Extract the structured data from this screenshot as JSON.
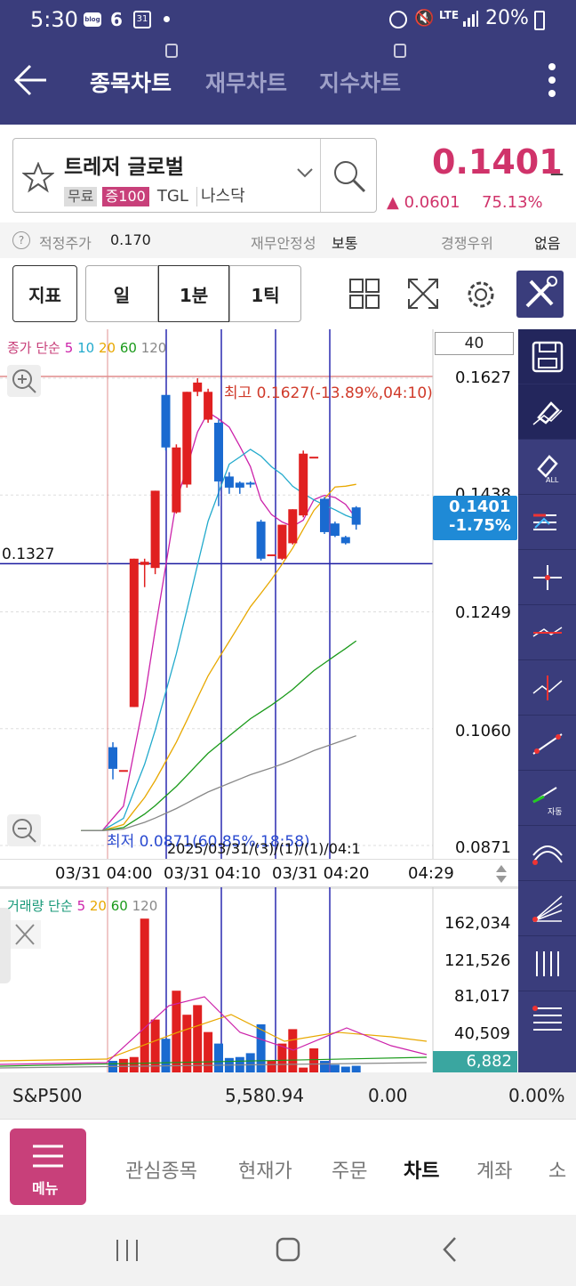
{
  "status": {
    "time": "5:30",
    "icons": [
      "blog-icon",
      "b-icon",
      "calendar-31-icon",
      "dot-icon"
    ],
    "calendar_day": "31",
    "blog": "blog",
    "network": "LTE",
    "battery": "20%"
  },
  "header": {
    "tabs": [
      "종목차트",
      "재무차트",
      "지수차트"
    ],
    "active_tab": 0
  },
  "stock": {
    "name": "트레저 글로벌",
    "badges": [
      "무료",
      "증100",
      "TGL",
      "나스닥"
    ],
    "price": "0.1401",
    "change": "▲ 0.0601",
    "change_pct": "75.13%",
    "price_suffix": "_"
  },
  "info": {
    "fair_price_label": "적정주가",
    "fair_price": "0.170",
    "stability_label": "재무안정성",
    "stability": "보통",
    "competitive_label": "경쟁우위",
    "competitive": "없음",
    "help": "?"
  },
  "toolbar": {
    "indicator": "지표",
    "periods": [
      "일",
      "1분",
      "1틱"
    ],
    "active_period": 1
  },
  "chart": {
    "count_box": "40",
    "ma_legend": {
      "prefix": "종가 단순",
      "periods": [
        "5",
        "10",
        "20",
        "60",
        "120"
      ],
      "colors": [
        "#cc22aa",
        "#22aacc",
        "#e8a800",
        "#1a9a1a",
        "#888888"
      ]
    },
    "high_label": "최고 0.1627(-13.89%,04:10)",
    "low_label": "최저 0.0871(60.85%,18:58)",
    "crosshair_price": "0.1327",
    "overlap_date": "2025/03/31/(3)/(1)/(1)/04:1",
    "current_price": "0.1401",
    "current_pct": "-1.75%",
    "y_ticks": [
      "0.1627",
      "0.1438",
      "0.1249",
      "0.1060",
      "0.0871"
    ],
    "x_ticks": [
      "03/31 04:00",
      "03/31 04:10",
      "03/31 04:20",
      "04:29"
    ],
    "volume_legend": {
      "prefix": "거래량 단순",
      "periods": [
        "5",
        "20",
        "60",
        "120"
      ],
      "colors": [
        "#cc22aa",
        "#e8a800",
        "#1a9a1a",
        "#888888"
      ]
    },
    "volume_ticks": [
      "162,034",
      "121,526",
      "81,017",
      "40,509"
    ],
    "volume_current": "6,882"
  },
  "chart_data": {
    "type": "candlestick",
    "ylim": [
      0.0871,
      0.1627
    ],
    "candles": [
      {
        "o": 0.103,
        "c": 0.0995,
        "h": 0.1038,
        "l": 0.0978
      },
      {
        "o": 0.0993,
        "c": 0.0993,
        "h": 0.0993,
        "l": 0.0993
      },
      {
        "o": 0.1095,
        "c": 0.1335,
        "h": 0.1335,
        "l": 0.1095
      },
      {
        "o": 0.1325,
        "c": 0.133,
        "h": 0.1335,
        "l": 0.1289
      },
      {
        "o": 0.132,
        "c": 0.1445,
        "h": 0.1445,
        "l": 0.131
      },
      {
        "o": 0.16,
        "c": 0.1515,
        "h": 0.16,
        "l": 0.151
      },
      {
        "o": 0.141,
        "c": 0.1515,
        "h": 0.152,
        "l": 0.1408
      },
      {
        "o": 0.1455,
        "c": 0.1605,
        "h": 0.1605,
        "l": 0.145
      },
      {
        "o": 0.1605,
        "c": 0.162,
        "h": 0.1627,
        "l": 0.1598
      },
      {
        "o": 0.156,
        "c": 0.1605,
        "h": 0.161,
        "l": 0.1555
      },
      {
        "o": 0.1555,
        "c": 0.146,
        "h": 0.156,
        "l": 0.142
      },
      {
        "o": 0.1468,
        "c": 0.145,
        "h": 0.1475,
        "l": 0.144
      },
      {
        "o": 0.1458,
        "c": 0.145,
        "h": 0.146,
        "l": 0.144
      },
      {
        "o": 0.1458,
        "c": 0.1455,
        "h": 0.146,
        "l": 0.145
      },
      {
        "o": 0.1395,
        "c": 0.1335,
        "h": 0.1398,
        "l": 0.1332
      },
      {
        "o": 0.1342,
        "c": 0.1342,
        "h": 0.1342,
        "l": 0.1342
      },
      {
        "o": 0.1335,
        "c": 0.139,
        "h": 0.139,
        "l": 0.1333
      },
      {
        "o": 0.136,
        "c": 0.1415,
        "h": 0.1415,
        "l": 0.1358
      },
      {
        "o": 0.1405,
        "c": 0.1505,
        "h": 0.151,
        "l": 0.1402
      },
      {
        "o": 0.15,
        "c": 0.15,
        "h": 0.15,
        "l": 0.15
      },
      {
        "o": 0.1432,
        "c": 0.1378,
        "h": 0.1435,
        "l": 0.1375
      },
      {
        "o": 0.1392,
        "c": 0.1372,
        "h": 0.1395,
        "l": 0.137
      },
      {
        "o": 0.137,
        "c": 0.136,
        "h": 0.1372,
        "l": 0.1358
      },
      {
        "o": 0.1418,
        "c": 0.139,
        "h": 0.142,
        "l": 0.1382
      }
    ],
    "volumes": [
      12000,
      14000,
      16000,
      160000,
      55000,
      35000,
      85000,
      60000,
      70000,
      42000,
      30000,
      15000,
      16000,
      20000,
      50000,
      12000,
      30000,
      45000,
      5000,
      25000,
      12000,
      8000,
      6000,
      6882
    ]
  },
  "sp": {
    "label": "S&P500",
    "value": "5,580.94",
    "change": "0.00",
    "pct": "0.00%"
  },
  "nav": {
    "menu": "메뉴",
    "items": [
      "관심종목",
      "현재가",
      "주문",
      "차트",
      "계좌",
      "소"
    ],
    "active": 3
  }
}
